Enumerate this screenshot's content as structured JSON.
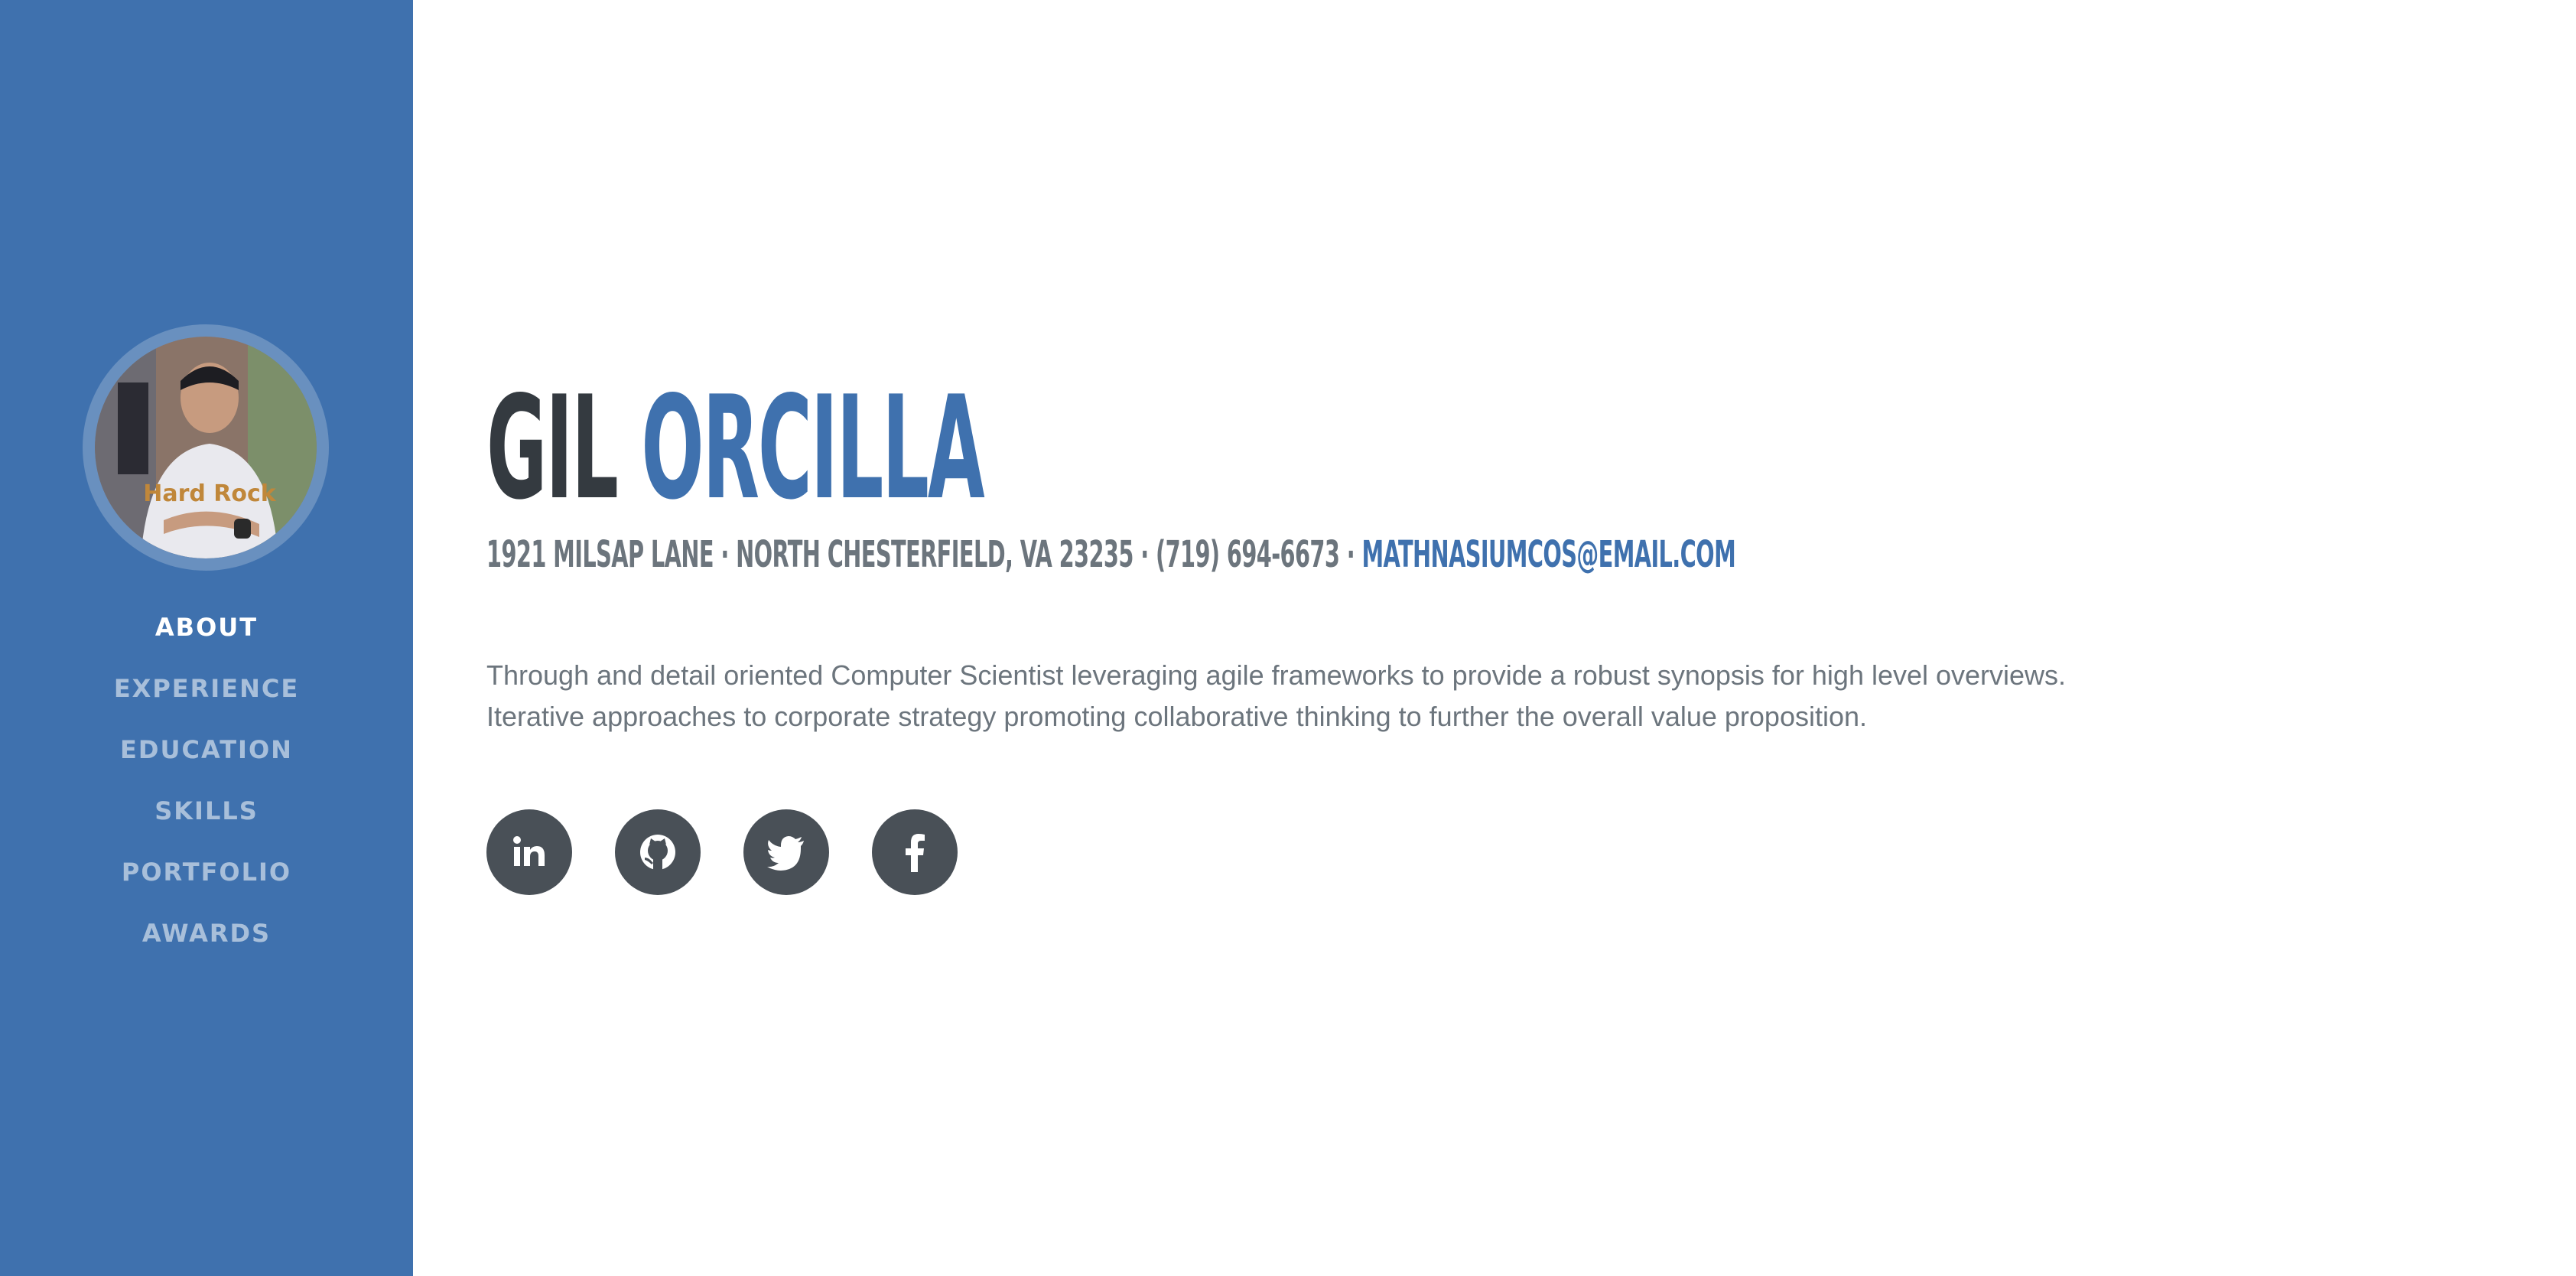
{
  "sidebar": {
    "avatar_alt": "profile photo",
    "nav": [
      {
        "label": "ABOUT",
        "active": true
      },
      {
        "label": "EXPERIENCE",
        "active": false
      },
      {
        "label": "EDUCATION",
        "active": false
      },
      {
        "label": "SKILLS",
        "active": false
      },
      {
        "label": "PORTFOLIO",
        "active": false
      },
      {
        "label": "AWARDS",
        "active": false
      }
    ]
  },
  "header": {
    "first_name": "GIL",
    "last_name": "ORCILLA"
  },
  "contact": {
    "address": "1921 MILSAP LANE · NORTH CHESTERFIELD, VA 23235 · (719) 694-6673 · ",
    "email": "MATHNASIUMCOS@EMAIL.COM"
  },
  "about": {
    "line1": "Through and detail oriented Computer Scientist leveraging agile frameworks to provide a robust synopsis for high level overviews.",
    "line2": "Iterative approaches to corporate strategy promoting collaborative thinking to further the overall value proposition."
  },
  "socials": [
    {
      "icon": "linkedin-icon"
    },
    {
      "icon": "github-icon"
    },
    {
      "icon": "twitter-icon"
    },
    {
      "icon": "facebook-icon"
    }
  ],
  "colors": {
    "primary": "#3f71ae",
    "dark": "#343a40",
    "muted": "#6c757d",
    "social_bg": "#495057"
  }
}
